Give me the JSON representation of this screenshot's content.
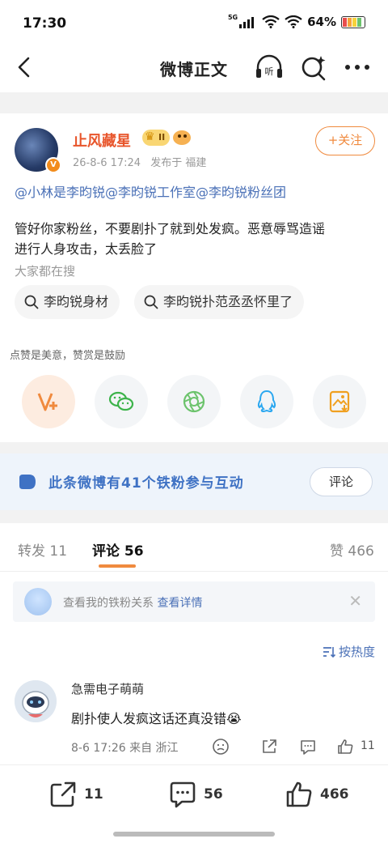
{
  "status_bar": {
    "time": "17:30",
    "network": "5G",
    "battery": "64%"
  },
  "nav": {
    "title": "微博正文",
    "icons": [
      "back-icon",
      "listen-icon",
      "search-ai-icon",
      "more-icon"
    ]
  },
  "post": {
    "author": "止风藏星",
    "level_badge": "II",
    "verified_badge": "V",
    "timestamp": "26-8-6 17:24",
    "location": "发布于 福建",
    "follow_label": "+关注",
    "mentions": [
      "@小林是李昀锐",
      "@李昀锐工作室",
      "@李昀锐粉丝团"
    ],
    "text_lines": [
      "管好你家粉丝，不要剧扑了就到处发疯。恶意辱骂造谣",
      "进行人身攻击，太丢脸了"
    ],
    "search_hint": "大家都在搜",
    "search_chips": [
      "李昀锐身材",
      "李昀锐扑范丞丞怀里了"
    ]
  },
  "reward": {
    "hint": "点赞是美意，赞赏是鼓励",
    "share_icons": [
      "weibo-reward-icon",
      "wechat-icon",
      "moments-icon",
      "qq-icon",
      "save-image-icon"
    ]
  },
  "iron_fans": {
    "text": "此条微博有41个铁粉参与互动",
    "button_label": "评论"
  },
  "tabs": {
    "repost": "转发 11",
    "comments": "评论 56",
    "likes_label": "赞",
    "likes_count": "466"
  },
  "fan_card": {
    "text": "查看我的铁粉关系",
    "link": "查看详情"
  },
  "sort_label": "按热度",
  "comment": {
    "name": "急需电子萌萌",
    "text": "剧扑使人发疯这话还真没错😭",
    "meta": "8-6 17:26  来自 浙江",
    "like_count": "11"
  },
  "bottom_bar": {
    "repost_count": "11",
    "comment_count": "56",
    "like_count": "466"
  },
  "colors": {
    "accent_orange": "#f08a3e",
    "author_name": "#e8552b",
    "link_blue": "#4b71b7"
  }
}
